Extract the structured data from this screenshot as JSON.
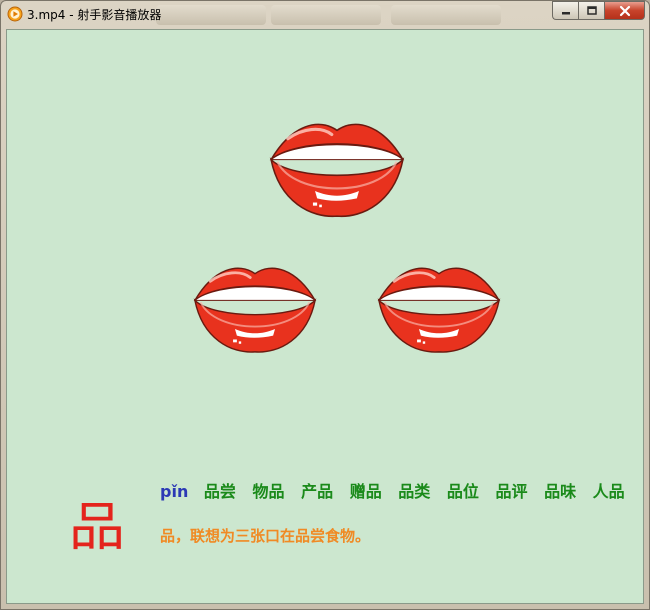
{
  "window": {
    "title": "3.mp4 - 射手影音播放器",
    "controls": {
      "minimize": "minimize-icon",
      "maximize": "maximize-icon",
      "close": "close-icon"
    }
  },
  "video": {
    "background": "#cce7cf",
    "character": "品",
    "pinyin": "pǐn",
    "words": [
      "品尝",
      "物品",
      "产品",
      "赠品",
      "品类",
      "品位",
      "品评",
      "品味",
      "人品"
    ],
    "sentence": "品，联想为三张口在品尝食物。",
    "colors": {
      "character": "#e4241c",
      "pinyin": "#2b39b5",
      "words": "#1a8a1a",
      "sentence": "#f08a24"
    }
  }
}
